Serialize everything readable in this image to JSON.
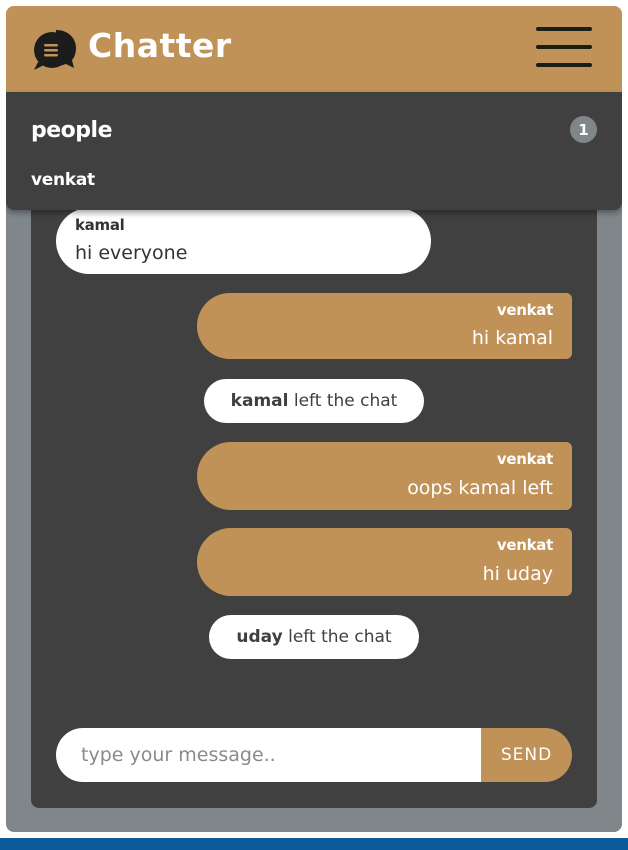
{
  "header": {
    "title": "Chatter",
    "logo_icon": "chat-bubble-icon",
    "menu_icon": "hamburger-icon"
  },
  "people": {
    "title": "people",
    "count": "1",
    "users": [
      "venkat"
    ]
  },
  "messages": [
    {
      "kind": "incoming",
      "sender": "kamal",
      "text": "hi everyone"
    },
    {
      "kind": "outgoing",
      "sender": "venkat",
      "text": "hi kamal"
    },
    {
      "kind": "notice",
      "user": "kamal",
      "text": "left the chat"
    },
    {
      "kind": "outgoing",
      "sender": "venkat",
      "text": "oops kamal left"
    },
    {
      "kind": "outgoing",
      "sender": "venkat",
      "text": "hi uday"
    },
    {
      "kind": "notice",
      "user": "uday",
      "text": "left the chat"
    }
  ],
  "composer": {
    "placeholder": "type your message..",
    "value": "",
    "send_label": "SEND"
  },
  "colors": {
    "brand": "#c09258",
    "panel": "#404040",
    "frame": "#7f878b",
    "accent_bar": "#0a5a9c"
  }
}
